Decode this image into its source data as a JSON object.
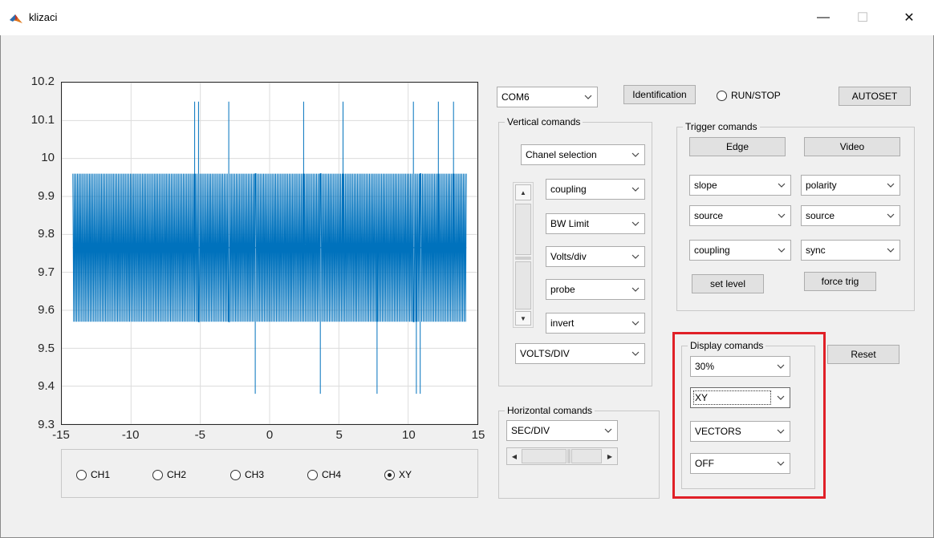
{
  "window": {
    "title": "klizaci",
    "minimize_glyph": "—",
    "maximize_glyph": "☐",
    "close_glyph": "✕",
    "icon": "matlab-icon"
  },
  "chart_data": {
    "type": "line",
    "x_ticks": [
      "-15",
      "-10",
      "-5",
      "0",
      "5",
      "10",
      "15"
    ],
    "y_ticks": [
      "10.2",
      "10.1",
      "10",
      "9.9",
      "9.8",
      "9.7",
      "9.6",
      "9.5",
      "9.4",
      "9.3"
    ],
    "xlim": [
      -15,
      15
    ],
    "ylim": [
      9.3,
      10.2
    ],
    "grid": true,
    "line_color": "#0072bd",
    "levels": [
      9.57,
      9.96
    ],
    "mid_level": 9.765,
    "x_range": [
      -14.2,
      14.2
    ],
    "spikes_up": [
      -5.4,
      -5.1,
      -2.9,
      2.5,
      5.3,
      10.4,
      12.2,
      13.3
    ],
    "spikes_down": [
      -1.0,
      3.7,
      7.8,
      10.6,
      10.9
    ],
    "spike_up_value": 10.15,
    "spike_down_value": 9.38
  },
  "channel_panel": {
    "radios": [
      {
        "label": "CH1",
        "selected": false
      },
      {
        "label": "CH2",
        "selected": false
      },
      {
        "label": "CH3",
        "selected": false
      },
      {
        "label": "CH4",
        "selected": false
      },
      {
        "label": "XY",
        "selected": true
      }
    ]
  },
  "top_controls": {
    "port_select": "COM6",
    "identification_label": "Identification",
    "run_stop_label": "RUN/STOP",
    "autoset_label": "AUTOSET"
  },
  "vertical": {
    "title": "Vertical comands",
    "channel_select": "Chanel selection",
    "coupling": "coupling",
    "bw_limit": "BW Limit",
    "volts_div": "Volts/div",
    "probe": "probe",
    "invert": "invert",
    "volts_div_select": "VOLTS/DIV",
    "scroll_up_glyph": "▲",
    "scroll_down_glyph": "▼"
  },
  "trigger": {
    "title": "Trigger comands",
    "edge_label": "Edge",
    "video_label": "Video",
    "slope": "slope",
    "polarity": "polarity",
    "source_left": "source",
    "source_right": "source",
    "coupling": "coupling",
    "sync": "sync",
    "set_level_label": "set level",
    "force_trig_label": "force trig"
  },
  "horizontal": {
    "title": "Horizontal comands",
    "sec_div": "SEC/DIV",
    "left_glyph": "◀",
    "right_glyph": "▶"
  },
  "display": {
    "title": "Display comands",
    "intensity": "30%",
    "format": "XY",
    "type": "VECTORS",
    "persist": "OFF",
    "reset_label": "Reset",
    "highlight_color": "#e02027"
  }
}
